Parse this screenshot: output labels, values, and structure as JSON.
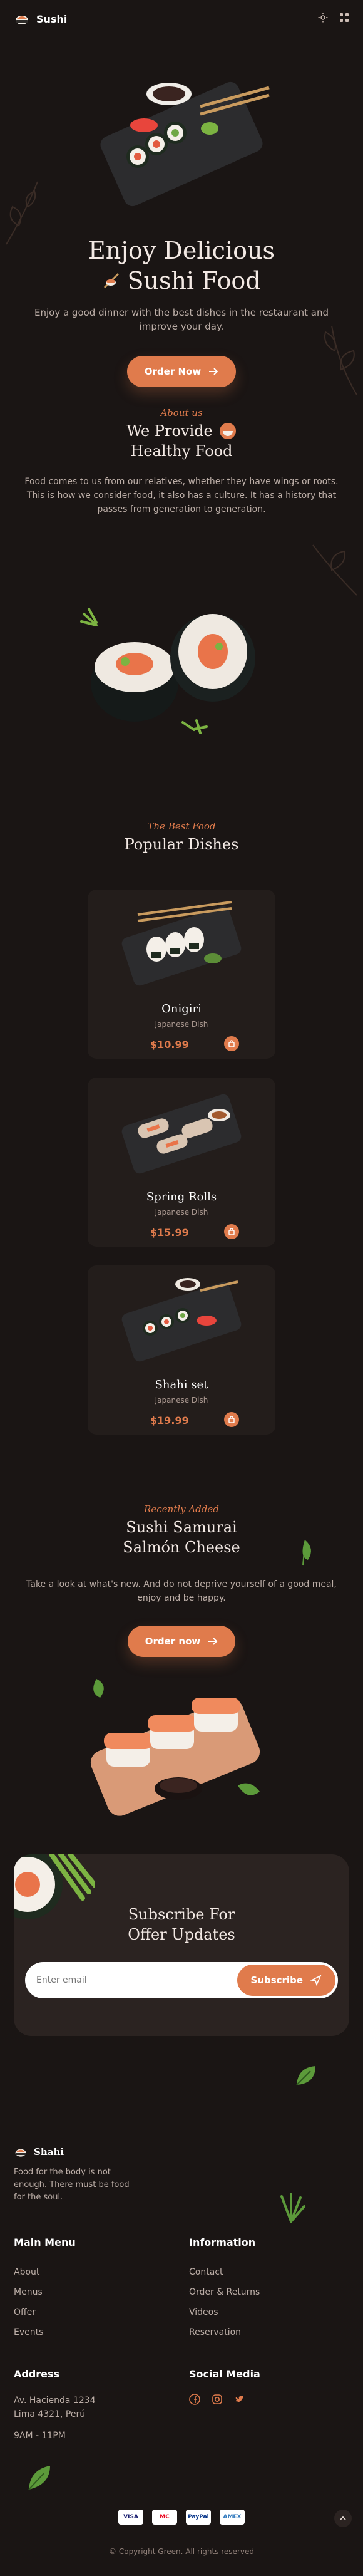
{
  "colors": {
    "accent": "#e07b4c",
    "bg": "#1a1514",
    "card": "#231d1b"
  },
  "header": {
    "brand": "Sushi",
    "icons": [
      "sun-icon",
      "grid-menu-icon"
    ]
  },
  "hero": {
    "title_line1": "Enjoy Delicious",
    "title_line2": "Sushi Food",
    "text": "Enjoy a good dinner with the best dishes in the restaurant and improve your day.",
    "button": "Order Now"
  },
  "about": {
    "subtitle": "About us",
    "title_line1": "We Provide",
    "title_line2": "Healthy Food",
    "text": "Food comes to us from our relatives, whether they have wings or roots. This is how we consider food, it also has a culture. It has a history that passes from generation to generation."
  },
  "popular": {
    "subtitle": "The Best Food",
    "title": "Popular Dishes",
    "dishes": [
      {
        "name": "Onigiri",
        "type": "Japanese Dish",
        "price": "$10.99"
      },
      {
        "name": "Spring Rolls",
        "type": "Japanese Dish",
        "price": "$15.99"
      },
      {
        "name": "Shahi set",
        "type": "Japanese Dish",
        "price": "$19.99"
      }
    ]
  },
  "recent": {
    "subtitle": "Recently Added",
    "title_line1": "Sushi Samurai",
    "title_line2": "Salmón Cheese",
    "text": "Take a look at what's new. And do not deprive yourself of a good meal, enjoy and be happy.",
    "button": "Order now"
  },
  "subscribe": {
    "title_line1": "Subscribe For",
    "title_line2": "Offer Updates",
    "placeholder": "Enter email",
    "button": "Subscribe"
  },
  "footer": {
    "brand": "Shahi",
    "tagline": "Food for the body is not enough. There must be food for the soul.",
    "main_menu": {
      "title": "Main Menu",
      "links": [
        "About",
        "Menus",
        "Offer",
        "Events"
      ]
    },
    "information": {
      "title": "Information",
      "links": [
        "Contact",
        "Order & Returns",
        "Videos",
        "Reservation"
      ]
    },
    "address": {
      "title": "Address",
      "line1": "Av. Hacienda 1234",
      "line2": "Lima 4321, Perú",
      "hours": "9AM - 11PM"
    },
    "social": {
      "title": "Social Media",
      "icons": [
        "facebook-icon",
        "instagram-icon",
        "twitter-icon"
      ]
    },
    "payments": [
      "VISA",
      "MC",
      "PayPal",
      "AMEX"
    ],
    "copyright": "© Copyright Green. All rights reserved"
  }
}
